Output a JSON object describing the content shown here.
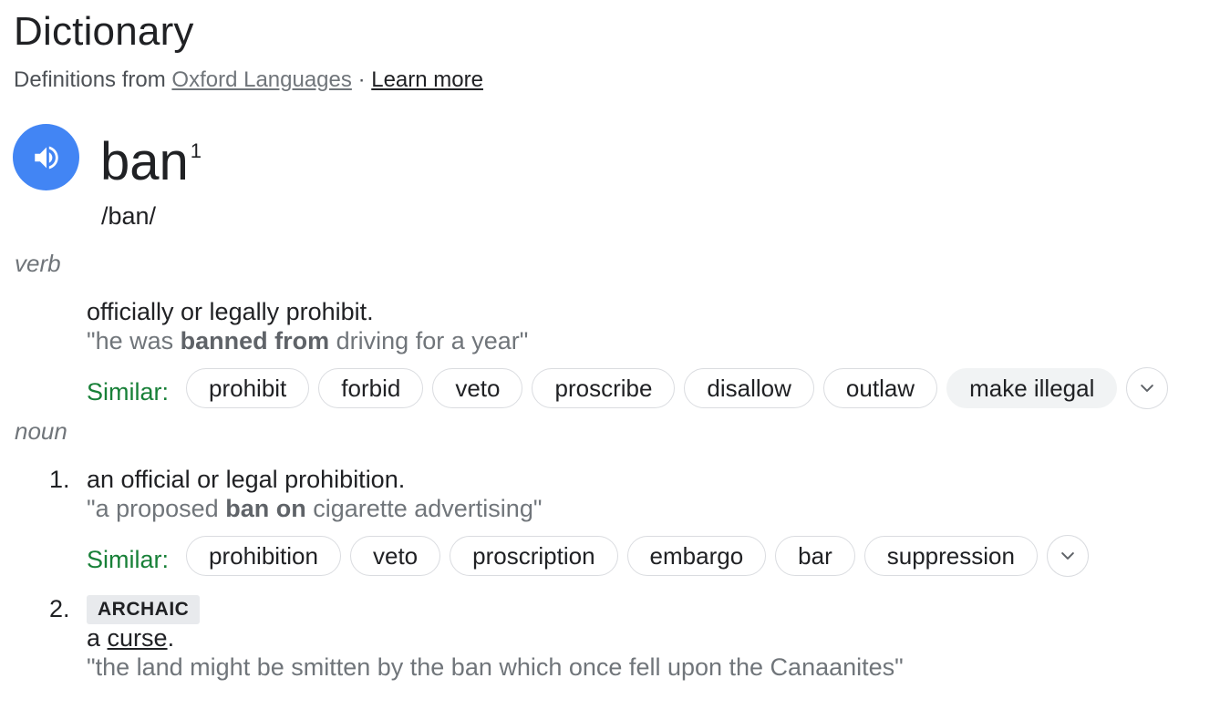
{
  "header": {
    "title": "Dictionary",
    "source_prefix": "Definitions from",
    "source_link": "Oxford Languages",
    "separator": "·",
    "learn_more": "Learn more"
  },
  "entry": {
    "word": "ban",
    "superscript": "1",
    "phonetic": "/ban/",
    "speaker_icon": "speaker-icon"
  },
  "verb": {
    "pos": "verb",
    "definition": "officially or legally prohibit.",
    "example_pre": "\"he was ",
    "example_bold": "banned from",
    "example_post": " driving for a year\"",
    "similar_label": "Similar:",
    "similar": [
      "prohibit",
      "forbid",
      "veto",
      "proscribe",
      "disallow",
      "outlaw",
      "make illegal"
    ]
  },
  "noun": {
    "pos": "noun",
    "senses": [
      {
        "number": "1.",
        "definition": "an official or legal prohibition.",
        "example_pre": "\"a proposed ",
        "example_bold": "ban on",
        "example_post": " cigarette advertising\"",
        "similar_label": "Similar:",
        "similar": [
          "prohibition",
          "veto",
          "proscription",
          "embargo",
          "bar",
          "suppression"
        ]
      },
      {
        "number": "2.",
        "tag": "ARCHAIC",
        "definition_pre": "a ",
        "definition_link": "curse",
        "definition_post": ".",
        "example": "\"the land might be smitten by the ban which once fell upon the Canaanites\""
      }
    ]
  },
  "colors": {
    "speaker_bg": "#4285f4",
    "similar_label": "#188038",
    "muted_text": "#70757a"
  }
}
